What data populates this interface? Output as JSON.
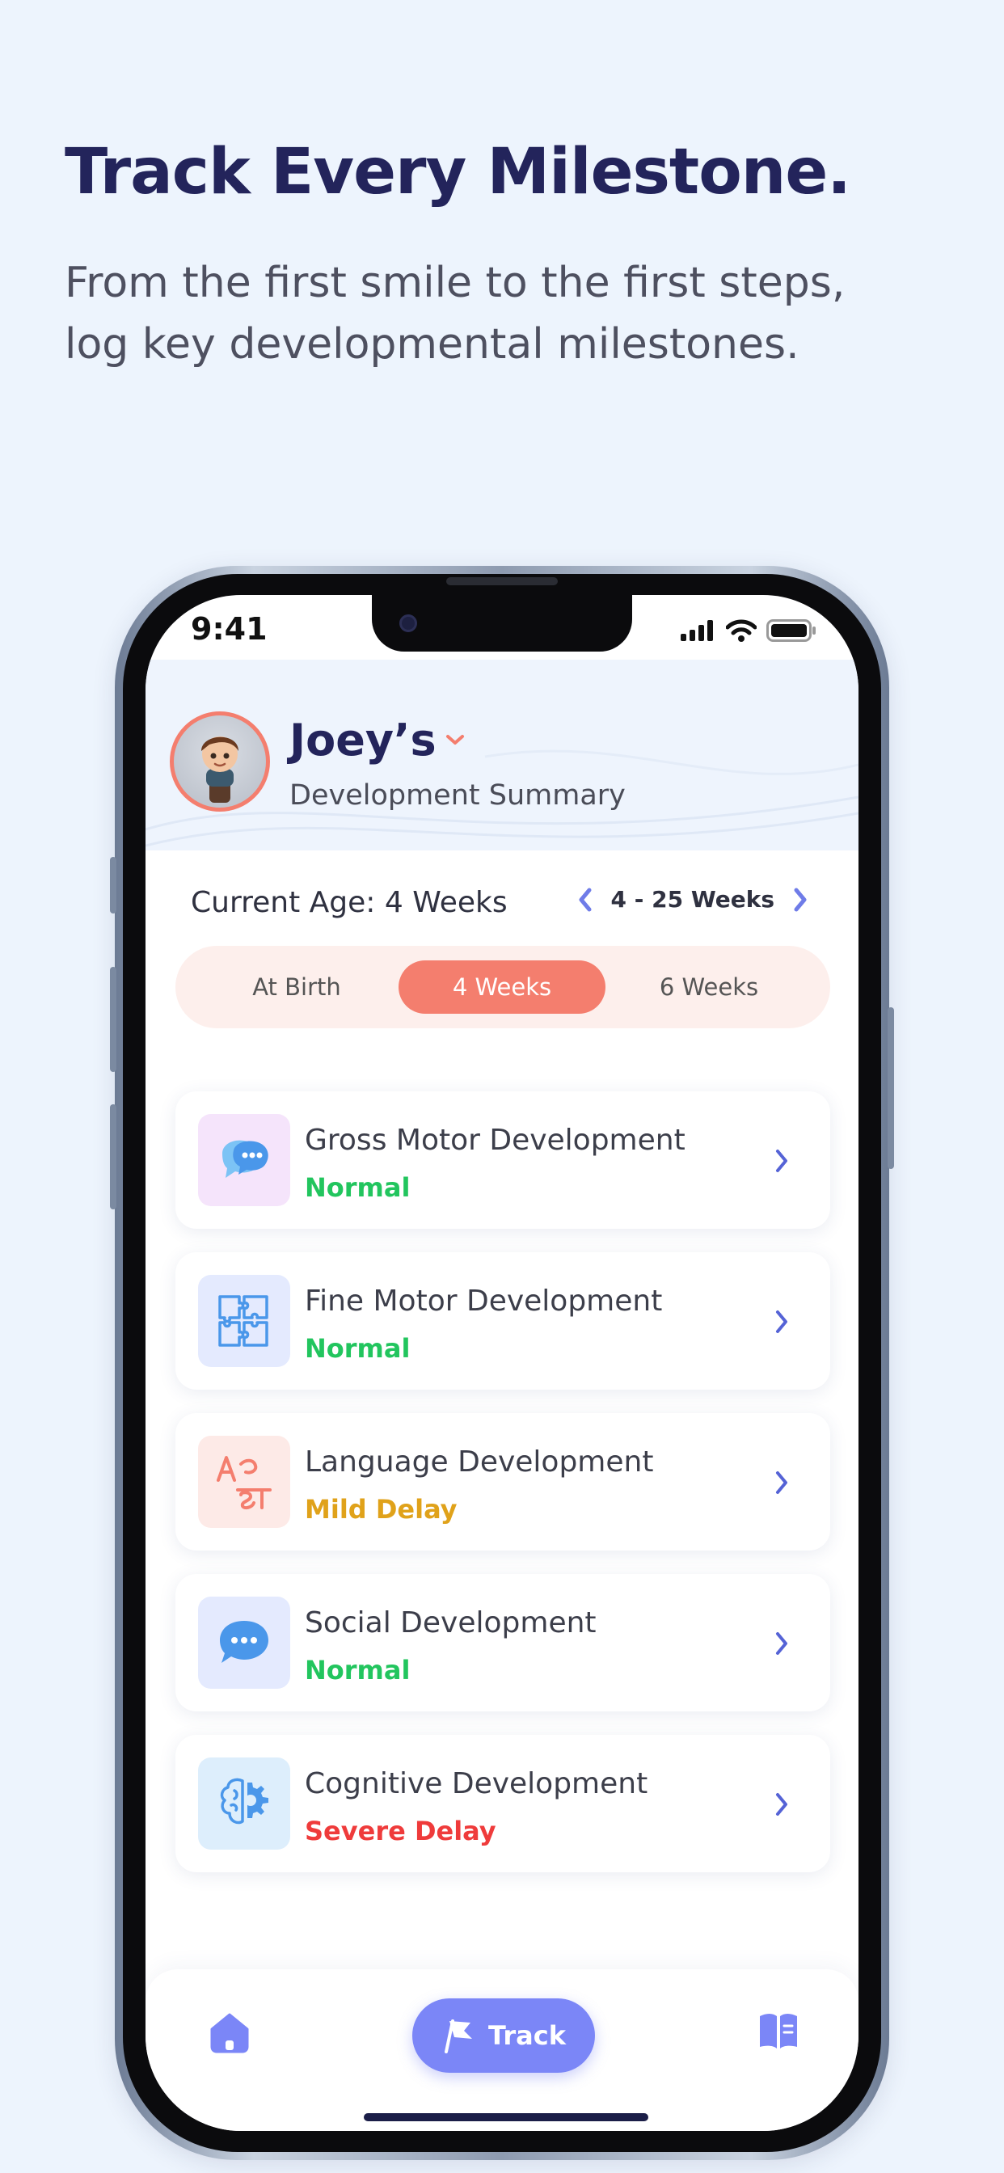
{
  "promo": {
    "headline": "Track Every Milestone.",
    "subline": "From the first smile to the first steps, log key developmental milestones."
  },
  "status_bar": {
    "time": "9:41"
  },
  "header": {
    "child_name": "Joey’s",
    "subtitle": "Development Summary"
  },
  "age": {
    "current_label": "Current Age: 4 Weeks",
    "range": "4 - 25 Weeks"
  },
  "age_tabs": [
    {
      "label": "At Birth",
      "selected": false
    },
    {
      "label": "4 Weeks",
      "selected": true
    },
    {
      "label": "6 Weeks",
      "selected": false
    }
  ],
  "categories": [
    {
      "title": "Gross Motor Development",
      "status": "Normal",
      "status_color": "#22c55e",
      "icon": "chat-bubbles-icon",
      "icon_bg": "#f5e4fb"
    },
    {
      "title": "Fine Motor Development",
      "status": "Normal",
      "status_color": "#22c55e",
      "icon": "puzzle-icon",
      "icon_bg": "#e4eafe"
    },
    {
      "title": "Language Development",
      "status": "Mild Delay",
      "status_color": "#e0a21a",
      "icon": "translate-icon",
      "icon_bg": "#fdeae7"
    },
    {
      "title": "Social Development",
      "status": "Normal",
      "status_color": "#22c55e",
      "icon": "chat-icon",
      "icon_bg": "#e4eafe"
    },
    {
      "title": "Cognitive Development",
      "status": "Severe Delay",
      "status_color": "#ef3b3b",
      "icon": "brain-gear-icon",
      "icon_bg": "#ddeefc"
    }
  ],
  "bottom_nav": {
    "track_label": "Track"
  },
  "colors": {
    "accent_coral": "#f47e6e",
    "accent_indigo": "#7b86f7",
    "headline": "#23245b"
  }
}
